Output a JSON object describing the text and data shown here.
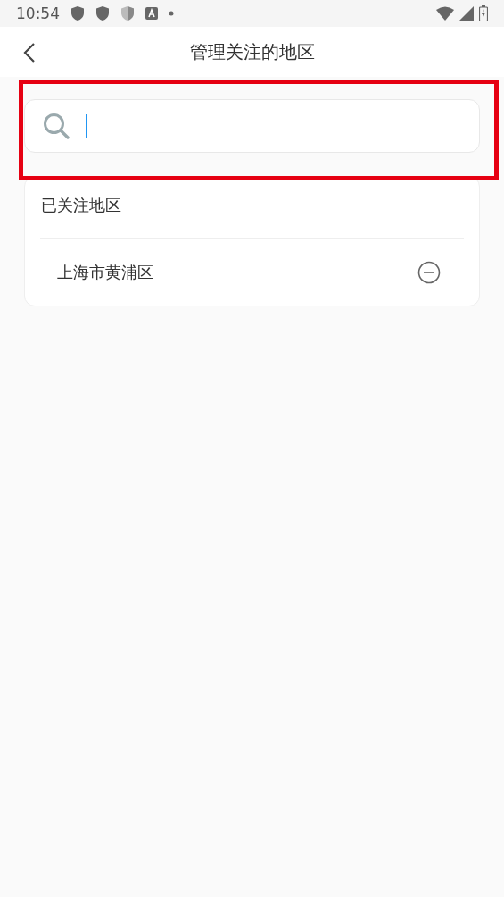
{
  "status_bar": {
    "time": "10:54"
  },
  "app_bar": {
    "title": "管理关注的地区"
  },
  "search": {
    "focused": true
  },
  "followed": {
    "heading": "已关注地区",
    "items": [
      {
        "name": "上海市黄浦区"
      }
    ]
  },
  "highlight": {
    "shown": true
  }
}
